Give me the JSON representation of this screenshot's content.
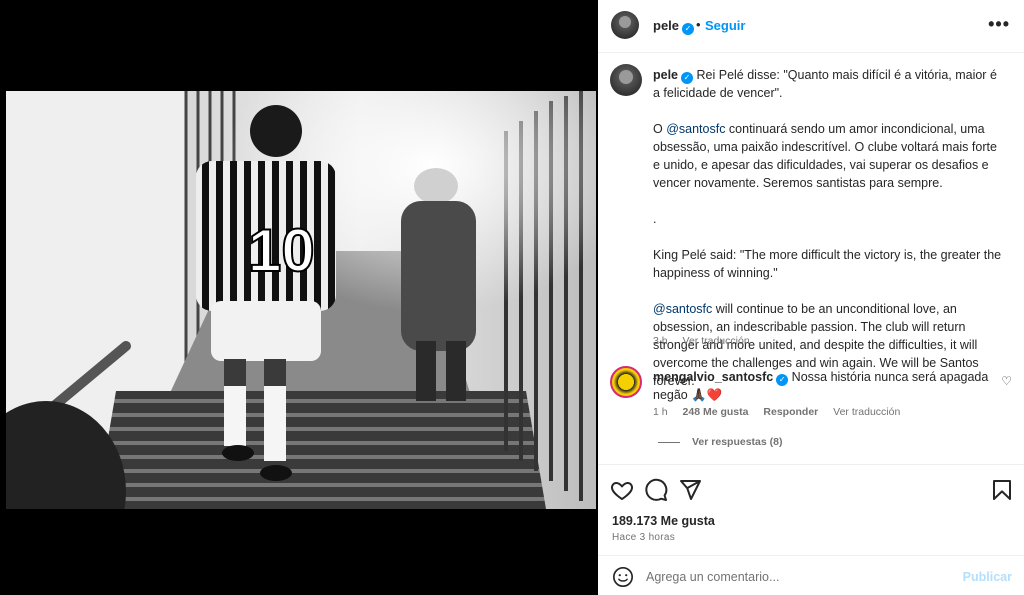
{
  "post": {
    "username": "pele",
    "follow_label": "Seguir",
    "separator": "•",
    "more_label": "•••"
  },
  "caption": {
    "username": "pele",
    "para1": "Rei Pelé disse: \"Quanto mais difícil é a vitória, maior é a felicidade de vencer\".",
    "para2_prefix": "O ",
    "para2_mention": "@santosfc",
    "para2_rest": " continuará sendo um amor incondicional, uma obsessão, uma paixão indescritível. O clube voltará mais forte e unido, e apesar das dificuldades, vai superar os desafios e vencer novamente. Seremos santistas para sempre.",
    "dot": ".",
    "para3": "King Pelé said: \"The more difficult the victory is, the greater the happiness of winning.\"",
    "para4_mention": "@santosfc",
    "para4_rest": " will continue to be an unconditional love, an obsession, an indescribable passion. The club will return stronger and more united, and despite the difficulties, it will overcome the challenges and win again. We will be Santos forever.",
    "time": "3 h",
    "translate": "Ver traducción"
  },
  "comment": {
    "username": "mengalvio_santosfc",
    "text": "Nossa história nunca será apagada negão 🙏🏿❤️",
    "time": "1 h",
    "likes": "248 Me gusta",
    "reply": "Responder",
    "translate": "Ver traducción",
    "view_replies": "Ver respuestas (8)"
  },
  "stats": {
    "likes": "189.173 Me gusta",
    "time": "Hace 3 horas"
  },
  "add_comment": {
    "placeholder": "Agrega un comentario...",
    "publish": "Publicar"
  },
  "icons": {
    "like": "heart-icon",
    "comment": "comment-icon",
    "share": "send-icon",
    "save": "bookmark-icon",
    "emoji": "emoji-icon"
  },
  "colors": {
    "accent": "#0095f6",
    "secondary_text": "#737373",
    "verified": "#0095f6"
  }
}
